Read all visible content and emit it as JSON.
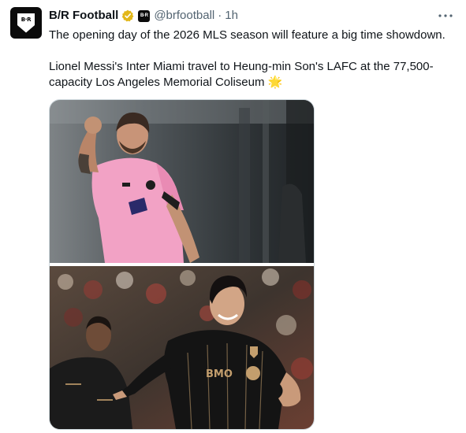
{
  "author": {
    "name": "B/R Football",
    "handle": "@brfootball",
    "separator": "·",
    "time": "1h",
    "avatar_text": "B·R",
    "affiliation_text": "B·R",
    "verified_color": "#e2b719"
  },
  "more_icon": "more-horizontal-icon",
  "tweet": {
    "line1": "The opening day of the 2026 MLS season will feature a big time showdown.",
    "line2": "Lionel Messi's Inter Miami travel to Heung-min Son's LAFC at the 77,500-capacity Los Angeles Memorial Coliseum",
    "emoji": "🌟"
  },
  "media": {
    "image_1": "messi-inter-miami-photo",
    "image_2": "son-lafc-photo",
    "jersey_text": "BMO"
  },
  "colors": {
    "text": "#0f1419",
    "secondary": "#536471",
    "border": "#cfd9de",
    "miami_pink": "#f4a6c8",
    "lafc_gold": "#c39e6d"
  }
}
